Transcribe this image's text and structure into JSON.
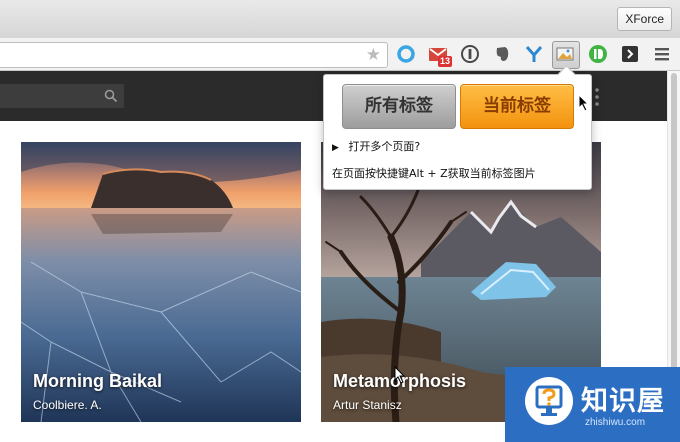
{
  "window": {
    "profile_button": "XForce"
  },
  "toolbar": {
    "extensions": [
      {
        "icon": "opera-circle-icon",
        "color": "#3aa7e4"
      },
      {
        "icon": "gmail-icon",
        "badge": "13",
        "color": "#d6463a"
      },
      {
        "icon": "info-circle-icon",
        "color": "#4a4a4a"
      },
      {
        "icon": "evernote-icon",
        "color": "#5a5a5a"
      },
      {
        "icon": "y-logo-icon",
        "color": "#2e88d1"
      },
      {
        "icon": "screenshot-icon",
        "color": "#e1a33b"
      },
      {
        "icon": "pushbullet-icon",
        "color": "#40b443"
      },
      {
        "icon": "pocket-dark-icon",
        "color": "#333333"
      },
      {
        "icon": "menu-icon",
        "color": "#555555"
      }
    ]
  },
  "popup": {
    "all_tabs_label": "所有标签",
    "current_tab_label": "当前标签",
    "open_multiple": "打开多个页面?",
    "hint": "在页面按快捷键Alt + Z获取当前标签图片"
  },
  "cards": [
    {
      "title": "Morning Baikal",
      "author": "Coolbiere. A."
    },
    {
      "title": "Metamorphosis",
      "author": "Artur Stanisz"
    }
  ],
  "watermark": {
    "title": "知识屋",
    "subtitle": "zhishiwu.com"
  },
  "colors": {
    "header": "#2b2b2b",
    "accent_orange": "#f3920f",
    "watermark_blue": "#2b6ec2"
  }
}
